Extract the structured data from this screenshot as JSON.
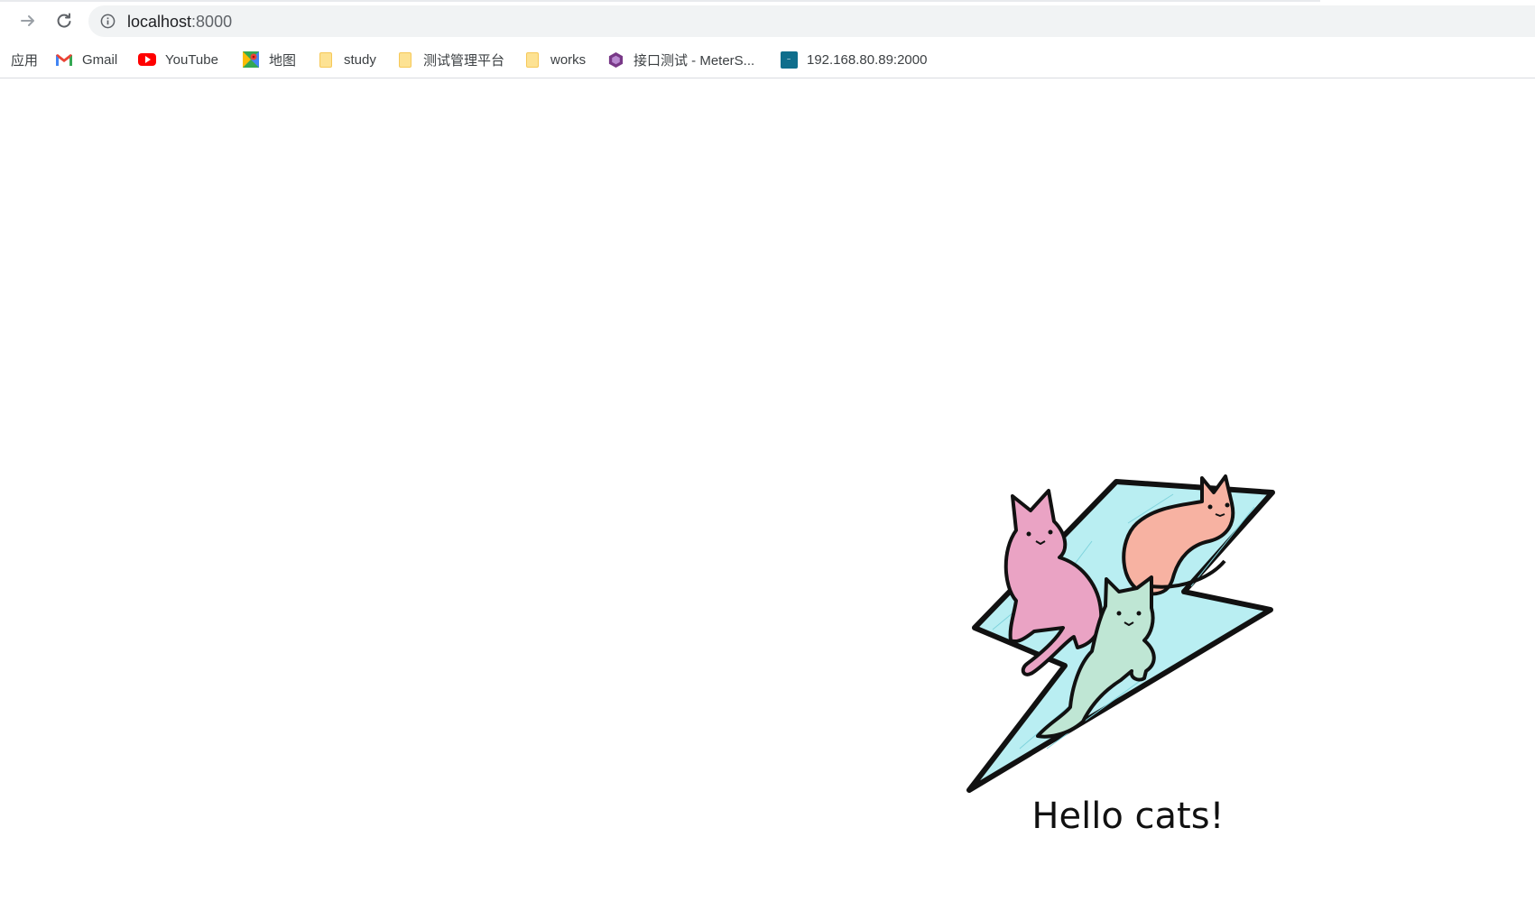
{
  "browser": {
    "url_host": "localhost",
    "url_port": ":8000",
    "forward_icon": "arrow-right-icon",
    "reload_icon": "reload-icon",
    "site_info_icon": "info-icon"
  },
  "bookmarks": [
    {
      "label": "应用",
      "icon": "apps"
    },
    {
      "label": "Gmail",
      "icon": "gmail-icon"
    },
    {
      "label": "YouTube",
      "icon": "youtube-icon"
    },
    {
      "label": "地图",
      "icon": "maps-icon"
    },
    {
      "label": "study",
      "icon": "folder-icon"
    },
    {
      "label": "测试管理平台",
      "icon": "folder-icon"
    },
    {
      "label": "works",
      "icon": "folder-icon"
    },
    {
      "label": "接口测试 - MeterS...",
      "icon": "metersphere-icon"
    },
    {
      "label": "192.168.80.89:2000",
      "icon": "site-icon"
    }
  ],
  "page": {
    "greeting": "Hello cats!",
    "image": "cats-on-lightning-bolt"
  },
  "colors": {
    "bolt_fill": "#b9eef2",
    "cat_pink": "#eaa3c4",
    "cat_peach": "#f7b2a2",
    "cat_mint": "#bfe6d4",
    "outline": "#111111"
  }
}
